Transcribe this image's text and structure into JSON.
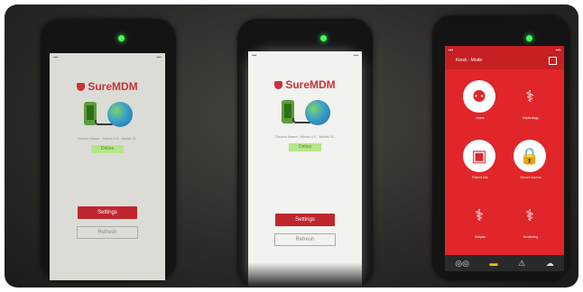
{
  "devices": [
    {
      "brand": "SureMDM",
      "device_info": "Device Name : Nazra 4.0 - Model XL",
      "status_badge": "Online",
      "settings_label": "Settings",
      "refresh_label": "Refresh"
    },
    {
      "brand": "SureMDM",
      "device_info": "Device Name : Nazra 4.0 - Model XL",
      "status_badge": "Online",
      "settings_label": "Settings",
      "refresh_label": "Refresh"
    },
    {
      "header_title": "Kiosk - Mode",
      "tiles": [
        {
          "icon": "people-icon",
          "glyph": "⚉",
          "label": "Users"
        },
        {
          "icon": "kidneys-icon",
          "glyph": "⚕",
          "label": "Nephrology"
        },
        {
          "icon": "id-card-icon",
          "glyph": "▣",
          "label": "Patient Info"
        },
        {
          "icon": "lock-icon",
          "glyph": "🔒",
          "label": "Secure Access"
        },
        {
          "icon": "kidneys-icon",
          "glyph": "⚕",
          "label": "Dialysis"
        },
        {
          "icon": "kidneys-icon",
          "glyph": "⚕",
          "label": "Monitoring"
        }
      ],
      "bottom_icons": [
        "glasses-icon",
        "battery-icon",
        "warning-icon",
        "cloud-icon"
      ]
    }
  ]
}
